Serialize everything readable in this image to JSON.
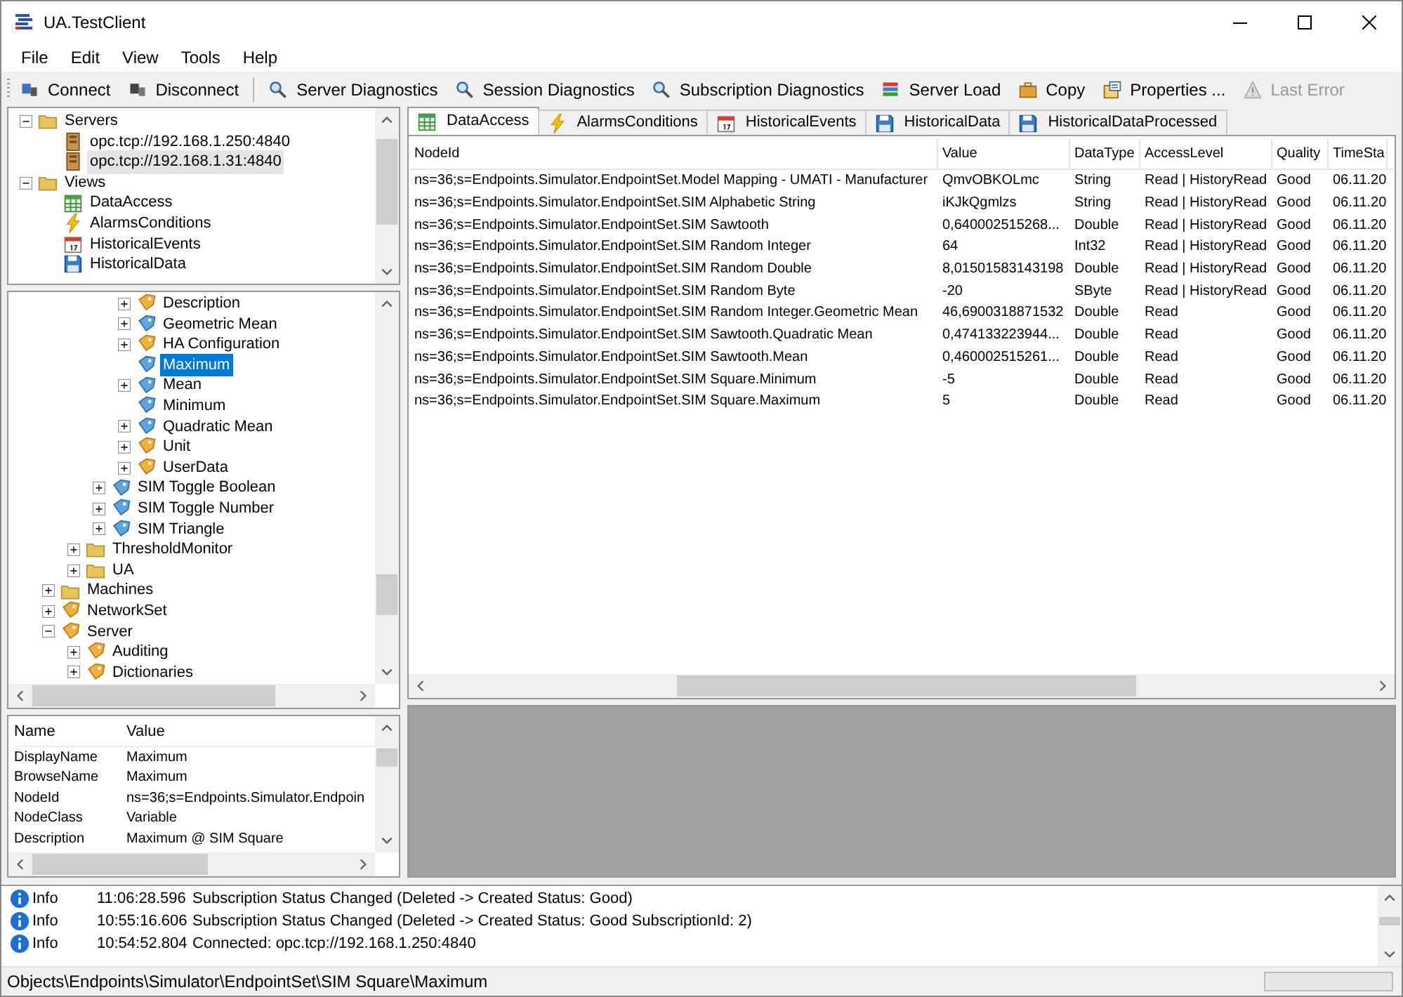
{
  "window": {
    "title": "UA.TestClient"
  },
  "menu": [
    "File",
    "Edit",
    "View",
    "Tools",
    "Help"
  ],
  "toolbar": [
    {
      "label": "Connect",
      "kind": "connect",
      "disabled": false
    },
    {
      "label": "Disconnect",
      "kind": "disconnect",
      "disabled": false
    },
    {
      "label": "Server Diagnostics",
      "kind": "search",
      "disabled": false
    },
    {
      "label": "Session Diagnostics",
      "kind": "search",
      "disabled": false
    },
    {
      "label": "Subscription Diagnostics",
      "kind": "search",
      "disabled": false
    },
    {
      "label": "Server Load",
      "kind": "load",
      "disabled": false
    },
    {
      "label": "Copy",
      "kind": "copy",
      "disabled": false
    },
    {
      "label": "Properties ...",
      "kind": "properties",
      "disabled": false
    },
    {
      "label": "Last Error",
      "kind": "warning",
      "disabled": true
    }
  ],
  "servers_tree": [
    {
      "label": "Servers",
      "kind": "folder",
      "expanded": true,
      "selected": false,
      "children": [
        {
          "label": "opc.tcp://192.168.1.250:4840",
          "kind": "server",
          "selected": false
        },
        {
          "label": "opc.tcp://192.168.1.31:4840",
          "kind": "server",
          "selected": true
        }
      ]
    },
    {
      "label": "Views",
      "kind": "folder",
      "expanded": true,
      "selected": false,
      "children": [
        {
          "label": "DataAccess",
          "kind": "grid",
          "selected": false
        },
        {
          "label": "AlarmsConditions",
          "kind": "bolt",
          "selected": false
        },
        {
          "label": "HistoricalEvents",
          "kind": "calendar",
          "selected": false
        },
        {
          "label": "HistoricalData",
          "kind": "disk",
          "selected": false
        }
      ]
    }
  ],
  "address_tree": [
    {
      "children": [
        {
          "children": [
            {
              "children": [
                {
                  "label": "Description",
                  "kind": "object",
                  "expanded": false,
                  "selected": false
                },
                {
                  "label": "Geometric Mean",
                  "kind": "variable",
                  "expanded": false,
                  "selected": false
                },
                {
                  "label": "HA Configuration",
                  "kind": "object",
                  "expanded": false,
                  "selected": false
                },
                {
                  "label": "Maximum",
                  "kind": "variable",
                  "selected": true
                },
                {
                  "label": "Mean",
                  "kind": "variable",
                  "expanded": false,
                  "selected": false
                },
                {
                  "label": "Minimum",
                  "kind": "variable",
                  "selected": false
                },
                {
                  "label": "Quadratic Mean",
                  "kind": "variable",
                  "expanded": false,
                  "selected": false
                },
                {
                  "label": "Unit",
                  "kind": "object",
                  "expanded": false,
                  "selected": false
                },
                {
                  "label": "UserData",
                  "kind": "object",
                  "expanded": false,
                  "selected": false
                }
              ]
            },
            {
              "label": "SIM Toggle Boolean",
              "kind": "variable",
              "expanded": false,
              "selected": false
            },
            {
              "label": "SIM Toggle Number",
              "kind": "variable",
              "expanded": false,
              "selected": false
            },
            {
              "label": "SIM Triangle",
              "kind": "variable",
              "expanded": false,
              "selected": false
            }
          ]
        },
        {
          "label": "ThresholdMonitor",
          "kind": "folder",
          "expanded": false,
          "selected": false
        },
        {
          "label": "UA",
          "kind": "folder",
          "expanded": false,
          "selected": false
        }
      ]
    },
    {
      "label": "Machines",
      "kind": "folder",
      "expanded": false,
      "selected": false
    },
    {
      "label": "NetworkSet",
      "kind": "object",
      "expanded": false,
      "selected": false
    },
    {
      "label": "Server",
      "kind": "object",
      "expanded": true,
      "selected": false,
      "children": [
        {
          "label": "Auditing",
          "kind": "object",
          "expanded": false,
          "selected": false
        },
        {
          "label": "Dictionaries",
          "kind": "object",
          "expanded": false,
          "selected": false
        }
      ]
    }
  ],
  "properties": {
    "columns": [
      "Name",
      "Value"
    ],
    "rows": [
      [
        "DisplayName",
        "Maximum"
      ],
      [
        "BrowseName",
        "Maximum"
      ],
      [
        "NodeId",
        "ns=36;s=Endpoints.Simulator.Endpoin"
      ],
      [
        "NodeClass",
        "Variable"
      ],
      [
        "Description",
        "Maximum @ SIM Square"
      ]
    ]
  },
  "tabs": [
    {
      "label": "DataAccess",
      "kind": "grid",
      "selected": true
    },
    {
      "label": "AlarmsConditions",
      "kind": "bolt",
      "selected": false
    },
    {
      "label": "HistoricalEvents",
      "kind": "calendar",
      "selected": false
    },
    {
      "label": "HistoricalData",
      "kind": "disk",
      "selected": false
    },
    {
      "label": "HistoricalDataProcessed",
      "kind": "disk",
      "selected": false
    }
  ],
  "table": {
    "columns": [
      "NodeId",
      "Value",
      "DataType",
      "AccessLevel",
      "Quality",
      "TimeSta"
    ],
    "rows": [
      [
        "ns=36;s=Endpoints.Simulator.EndpointSet.Model Mapping - UMATI - Manufacturer",
        "QmvOBKOLmc",
        "String",
        "Read | HistoryRead",
        "Good",
        "06.11.20"
      ],
      [
        "ns=36;s=Endpoints.Simulator.EndpointSet.SIM Alphabetic String",
        "iKJkQgmlzs",
        "String",
        "Read | HistoryRead",
        "Good",
        "06.11.20"
      ],
      [
        "ns=36;s=Endpoints.Simulator.EndpointSet.SIM Sawtooth",
        "0,640002515268...",
        "Double",
        "Read | HistoryRead",
        "Good",
        "06.11.20"
      ],
      [
        "ns=36;s=Endpoints.Simulator.EndpointSet.SIM Random Integer",
        "64",
        "Int32",
        "Read | HistoryRead",
        "Good",
        "06.11.20"
      ],
      [
        "ns=36;s=Endpoints.Simulator.EndpointSet.SIM Random Double",
        "8,01501583143198",
        "Double",
        "Read | HistoryRead",
        "Good",
        "06.11.20"
      ],
      [
        "ns=36;s=Endpoints.Simulator.EndpointSet.SIM Random Byte",
        "-20",
        "SByte",
        "Read | HistoryRead",
        "Good",
        "06.11.20"
      ],
      [
        "ns=36;s=Endpoints.Simulator.EndpointSet.SIM Random Integer.Geometric Mean",
        "46,6900318871532",
        "Double",
        "Read",
        "Good",
        "06.11.20"
      ],
      [
        "ns=36;s=Endpoints.Simulator.EndpointSet.SIM Sawtooth.Quadratic Mean",
        "0,474133223944...",
        "Double",
        "Read",
        "Good",
        "06.11.20"
      ],
      [
        "ns=36;s=Endpoints.Simulator.EndpointSet.SIM Sawtooth.Mean",
        "0,460002515261...",
        "Double",
        "Read",
        "Good",
        "06.11.20"
      ],
      [
        "ns=36;s=Endpoints.Simulator.EndpointSet.SIM Square.Minimum",
        "-5",
        "Double",
        "Read",
        "Good",
        "06.11.20"
      ],
      [
        "ns=36;s=Endpoints.Simulator.EndpointSet.SIM Square.Maximum",
        "5",
        "Double",
        "Read",
        "Good",
        "06.11.20"
      ]
    ]
  },
  "log": [
    {
      "level": "Info",
      "time": "11:06:28.596",
      "message": "Subscription Status Changed (Deleted -> Created Status: Good)"
    },
    {
      "level": "Info",
      "time": "10:55:16.606",
      "message": "Subscription Status Changed (Deleted -> Created Status: Good SubscriptionId: 2)"
    },
    {
      "level": "Info",
      "time": "10:54:52.804",
      "message": "Connected: opc.tcp://192.168.1.250:4840"
    }
  ],
  "status_bar": {
    "path": "Objects\\Endpoints\\Simulator\\EndpointSet\\SIM Square\\Maximum"
  }
}
